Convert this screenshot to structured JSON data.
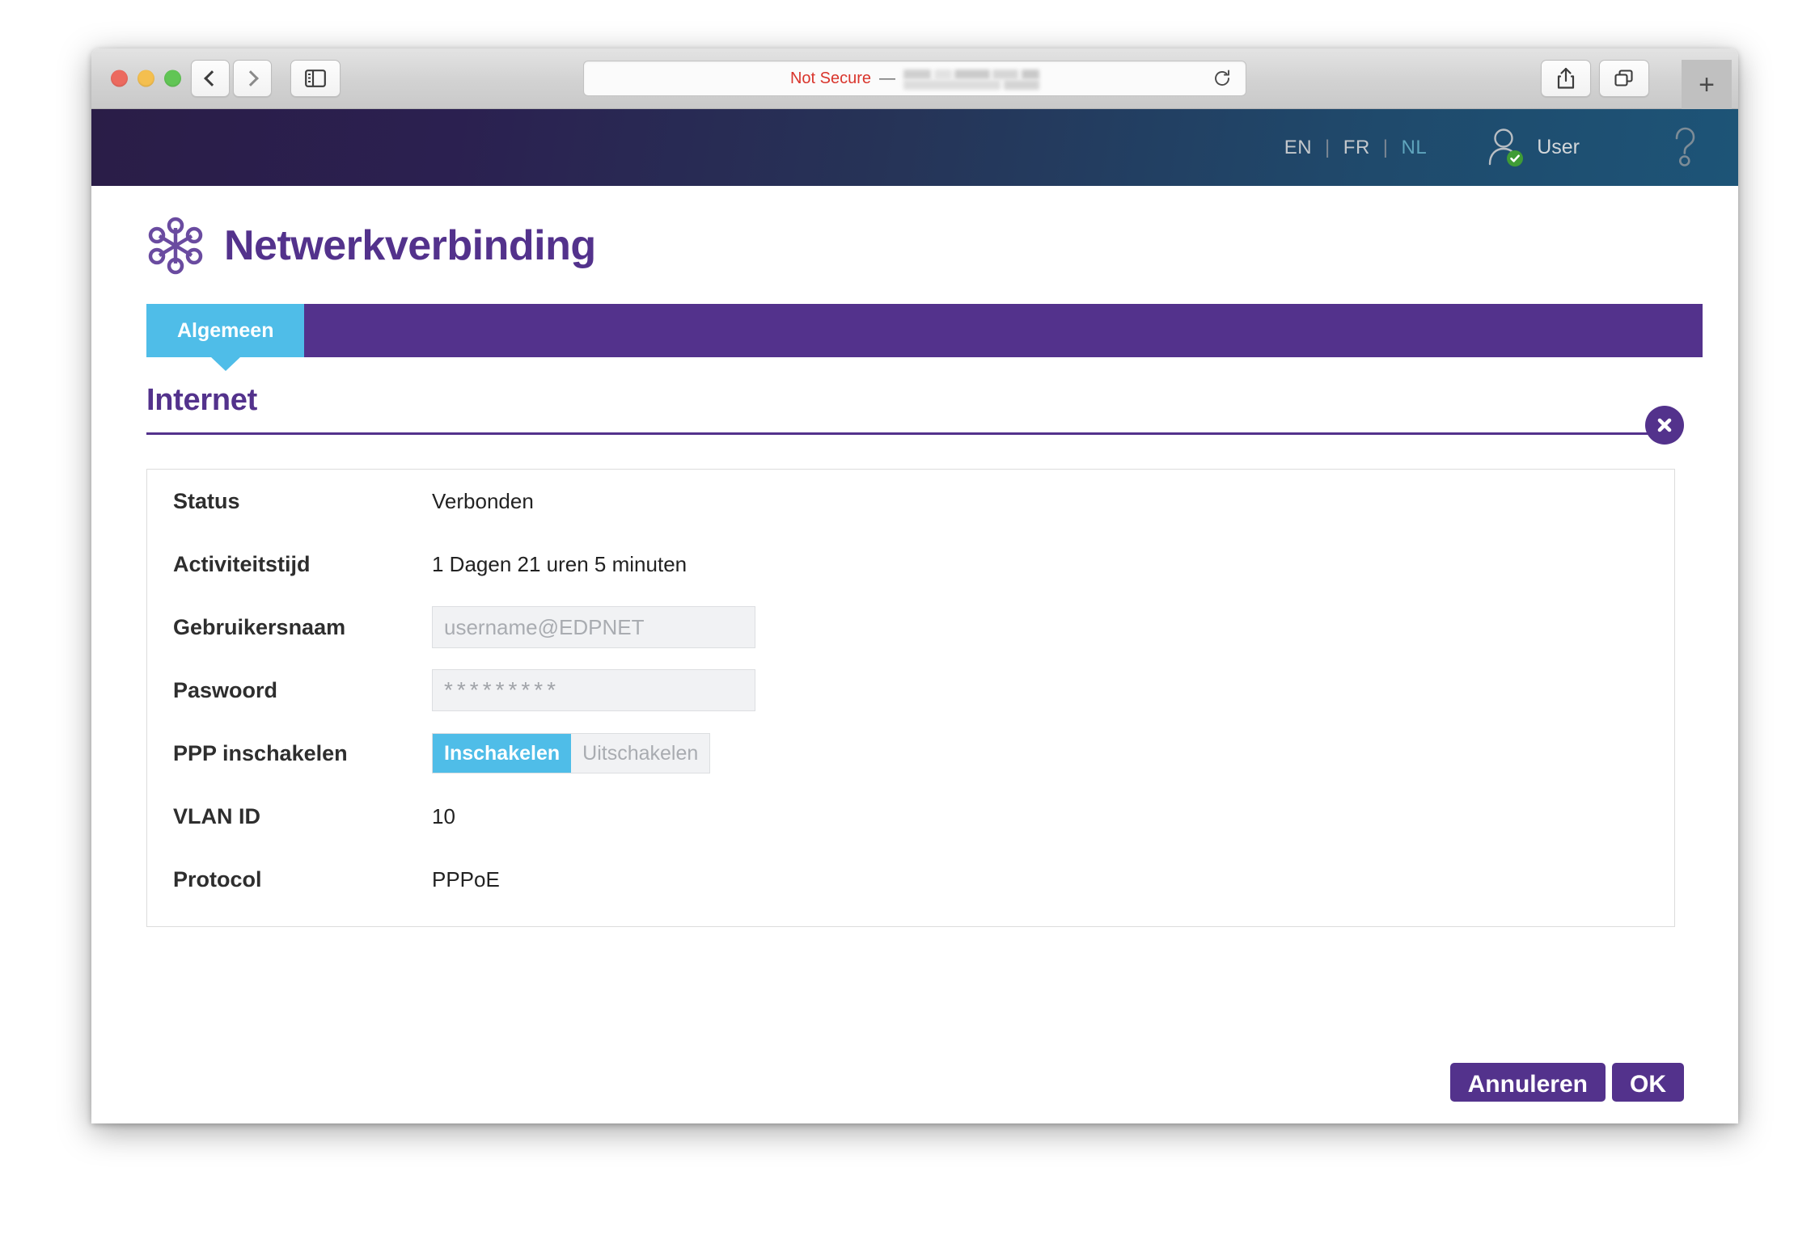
{
  "browser": {
    "window_controls": [
      "close",
      "minimize",
      "zoom"
    ],
    "back_icon": "chevron-left-icon",
    "forward_icon": "chevron-right-icon",
    "sidebar_icon": "sidebar-icon",
    "share_icon": "share-icon",
    "tabs_icon": "tab-overview-icon",
    "new_tab_label": "+",
    "url_bar": {
      "security_label": "Not Secure",
      "separator": "—",
      "url_redacted": true,
      "reload_icon": "reload-icon"
    }
  },
  "site_header": {
    "languages": [
      {
        "code": "EN",
        "active": false
      },
      {
        "code": "FR",
        "active": false
      },
      {
        "code": "NL",
        "active": true
      }
    ],
    "separator": "|",
    "user": {
      "label": "User",
      "icon": "user-icon",
      "badge_icon": "verified-check-icon"
    },
    "help_icon": "question-mark-icon",
    "gradient_from": "#2a1d47",
    "gradient_to": "#1d5477"
  },
  "dialog": {
    "title": "Netwerkverbinding",
    "logo_icon": "network-hub-icon",
    "close_icon": "close-circle-icon",
    "accent_color": "#53328C",
    "tab_active_color": "#4FBDE8",
    "tabs": [
      {
        "label": "Algemeen",
        "active": true
      }
    ],
    "section_heading": "Internet",
    "rows": [
      {
        "label": "Status",
        "type": "text",
        "value": "Verbonden"
      },
      {
        "label": "Activiteitstijd",
        "type": "text",
        "value": "1 Dagen 21 uren 5 minuten"
      },
      {
        "label": "Gebruikersnaam",
        "type": "input",
        "value": "username@EDPNET"
      },
      {
        "label": "Paswoord",
        "type": "password",
        "value": "*********"
      },
      {
        "label": "PPP inschakelen",
        "type": "toggle",
        "on_label": "Inschakelen",
        "off_label": "Uitschakelen",
        "selected": "on"
      },
      {
        "label": "VLAN ID",
        "type": "text",
        "value": "10"
      },
      {
        "label": "Protocol",
        "type": "text",
        "value": "PPPoE"
      }
    ],
    "actions": {
      "cancel_label": "Annuleren",
      "ok_label": "OK"
    }
  }
}
